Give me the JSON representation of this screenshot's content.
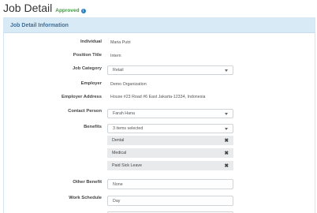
{
  "page": {
    "title": "Job Detail",
    "status": "Approved",
    "info_icon": "i"
  },
  "panel": {
    "heading": "Job Detail Information"
  },
  "fields": {
    "individual": {
      "label": "Individual",
      "value": "Maria Putri"
    },
    "position_title": {
      "label": "Position Title",
      "value": "Intern"
    },
    "job_category": {
      "label": "Job Category",
      "value": "Retail"
    },
    "employer": {
      "label": "Employer",
      "value": "Demo Organization"
    },
    "employer_address": {
      "label": "Employer Address",
      "value": "House #23 Road #6 East Jakarta-12334, Indonesia"
    },
    "contact_person": {
      "label": "Contact Person",
      "value": "Farah Hana"
    },
    "benefits": {
      "label": "Benefits",
      "summary": "3 items selected",
      "selected": [
        "Dental",
        "Medical",
        "Paid Sick Leave"
      ],
      "remove_glyph": "✖"
    },
    "other_benefit": {
      "label": "Other Benefit",
      "value": "None"
    },
    "work_schedule": {
      "label": "Work Schedule",
      "value": "Day"
    }
  }
}
